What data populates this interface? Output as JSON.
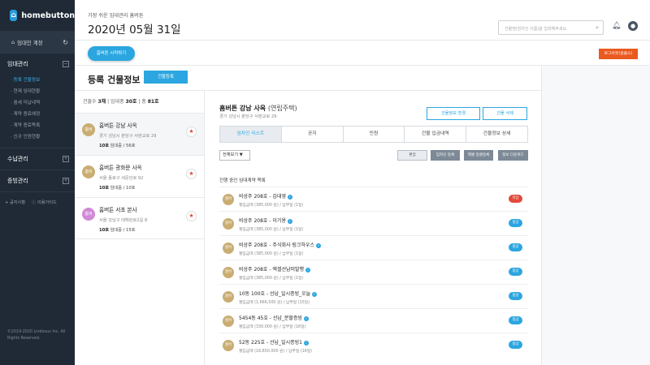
{
  "sidebar": {
    "brand": "homebutton",
    "account": "임대인 계정",
    "sections": [
      {
        "title": "임대관리",
        "items": [
          "· 등록 건물정보",
          "· 현재 임대현황",
          "· 월세 미납내역",
          "· 계약 종료예정",
          "· 계약 종료목록",
          "· 신규 인원현황"
        ]
      },
      {
        "title": "수납관리"
      },
      {
        "title": "증빙관리"
      }
    ],
    "quick": [
      "+ 공지사항",
      "이용가이드"
    ],
    "copyright": [
      "©2019-2020 Linkbous Inc. All",
      "Rights Reserved."
    ]
  },
  "header": {
    "tagline": "가장 쉬운 임대관리 홈버튼",
    "date": "2020년 05월 31일",
    "search_placeholder": "건물명(임차인 이름)을 입력해주세요.",
    "start_button": "홈버튼 시작하기",
    "logout_button": "로그아웃(원플스)"
  },
  "page": {
    "title": "등록 건물정보",
    "register_button": "건물등록",
    "counts": {
      "prefix": "건물수",
      "buildings": "3채",
      "rooms_label": "임대중",
      "rooms": "30호",
      "total_label": "총",
      "total": "81호"
    }
  },
  "buildings": [
    {
      "avatar": "홈버",
      "avatar_color": "#c9ad73",
      "name": "홈버튼 강남 사옥",
      "address": "경기 성남시 분당구 서판교로 29",
      "leased": "10호",
      "total": "56호"
    },
    {
      "avatar": "홈버",
      "avatar_color": "#c9ad73",
      "name": "홈버튼 광화문 사옥",
      "address": "서울 종로구 세문안로 92",
      "leased": "10호",
      "total": "10호"
    },
    {
      "avatar": "홈버",
      "avatar_color": "#d18ad6",
      "name": "홈버튼 서초 본사",
      "address": "서울 강남구 테헤란로2길 8",
      "leased": "10호",
      "total": "15호"
    }
  ],
  "detail": {
    "name": "홈버튼 강남 사옥",
    "type": "(연립주택)",
    "address": "경기 성남시 분당구 서판교로 29",
    "edit_button": "건물정보 변경",
    "delete_button": "건물 삭제",
    "tabs": [
      "임차인 리스트",
      "공지",
      "민원",
      "건물 입금내역",
      "건물정보 상세"
    ],
    "filter": "전체보기 ▼",
    "actions": [
      "편집",
      "임차인 등록",
      "엑셀 일괄등록",
      "정보 다운로드"
    ],
    "section_title": "진행 중인 임대계약 목록"
  },
  "tenants": [
    {
      "avatar": "홈버",
      "name": "비상주 208호 - 김대영",
      "sub": "월임금액 (385,000 원) / 납부일 (1일)",
      "status": "미납",
      "status_type": "red"
    },
    {
      "avatar": "홈버",
      "name": "비상주 208호 - 이기용",
      "sub": "월임금액 (385,000 원) / 납부일 (1일)",
      "status": "정상",
      "status_type": "blue"
    },
    {
      "avatar": "홈버",
      "name": "비상주 208호 - 주식회사 링크하우스",
      "sub": "월임금액 (385,000 원) / 납부일 (1일)",
      "status": "정상",
      "status_type": "blue"
    },
    {
      "avatar": "홈버",
      "name": "비상주 208호 - 엑셀선납미발행",
      "sub": "월임금액 (385,000 원) / 납부일 (1일)",
      "status": "정상",
      "status_type": "blue"
    },
    {
      "avatar": "홈버",
      "name": "10동 100호 - 선납_일시증빙_오늘",
      "sub": "월임금액 (1,666,500 원) / 납부일 (15일)",
      "status": "정상",
      "status_type": "blue"
    },
    {
      "avatar": "홈버",
      "name": "5454동 45호 - 선납_분할증빙",
      "sub": "월임금액 (330,000 원) / 납부일 (16일)",
      "status": "정상",
      "status_type": "blue"
    },
    {
      "avatar": "홈버",
      "name": "52동 225호 - 선납_일시증빙1",
      "sub": "월임금액 (16,650,000 원) / 납부일 (16일)",
      "status": "정상",
      "status_type": "blue"
    }
  ]
}
